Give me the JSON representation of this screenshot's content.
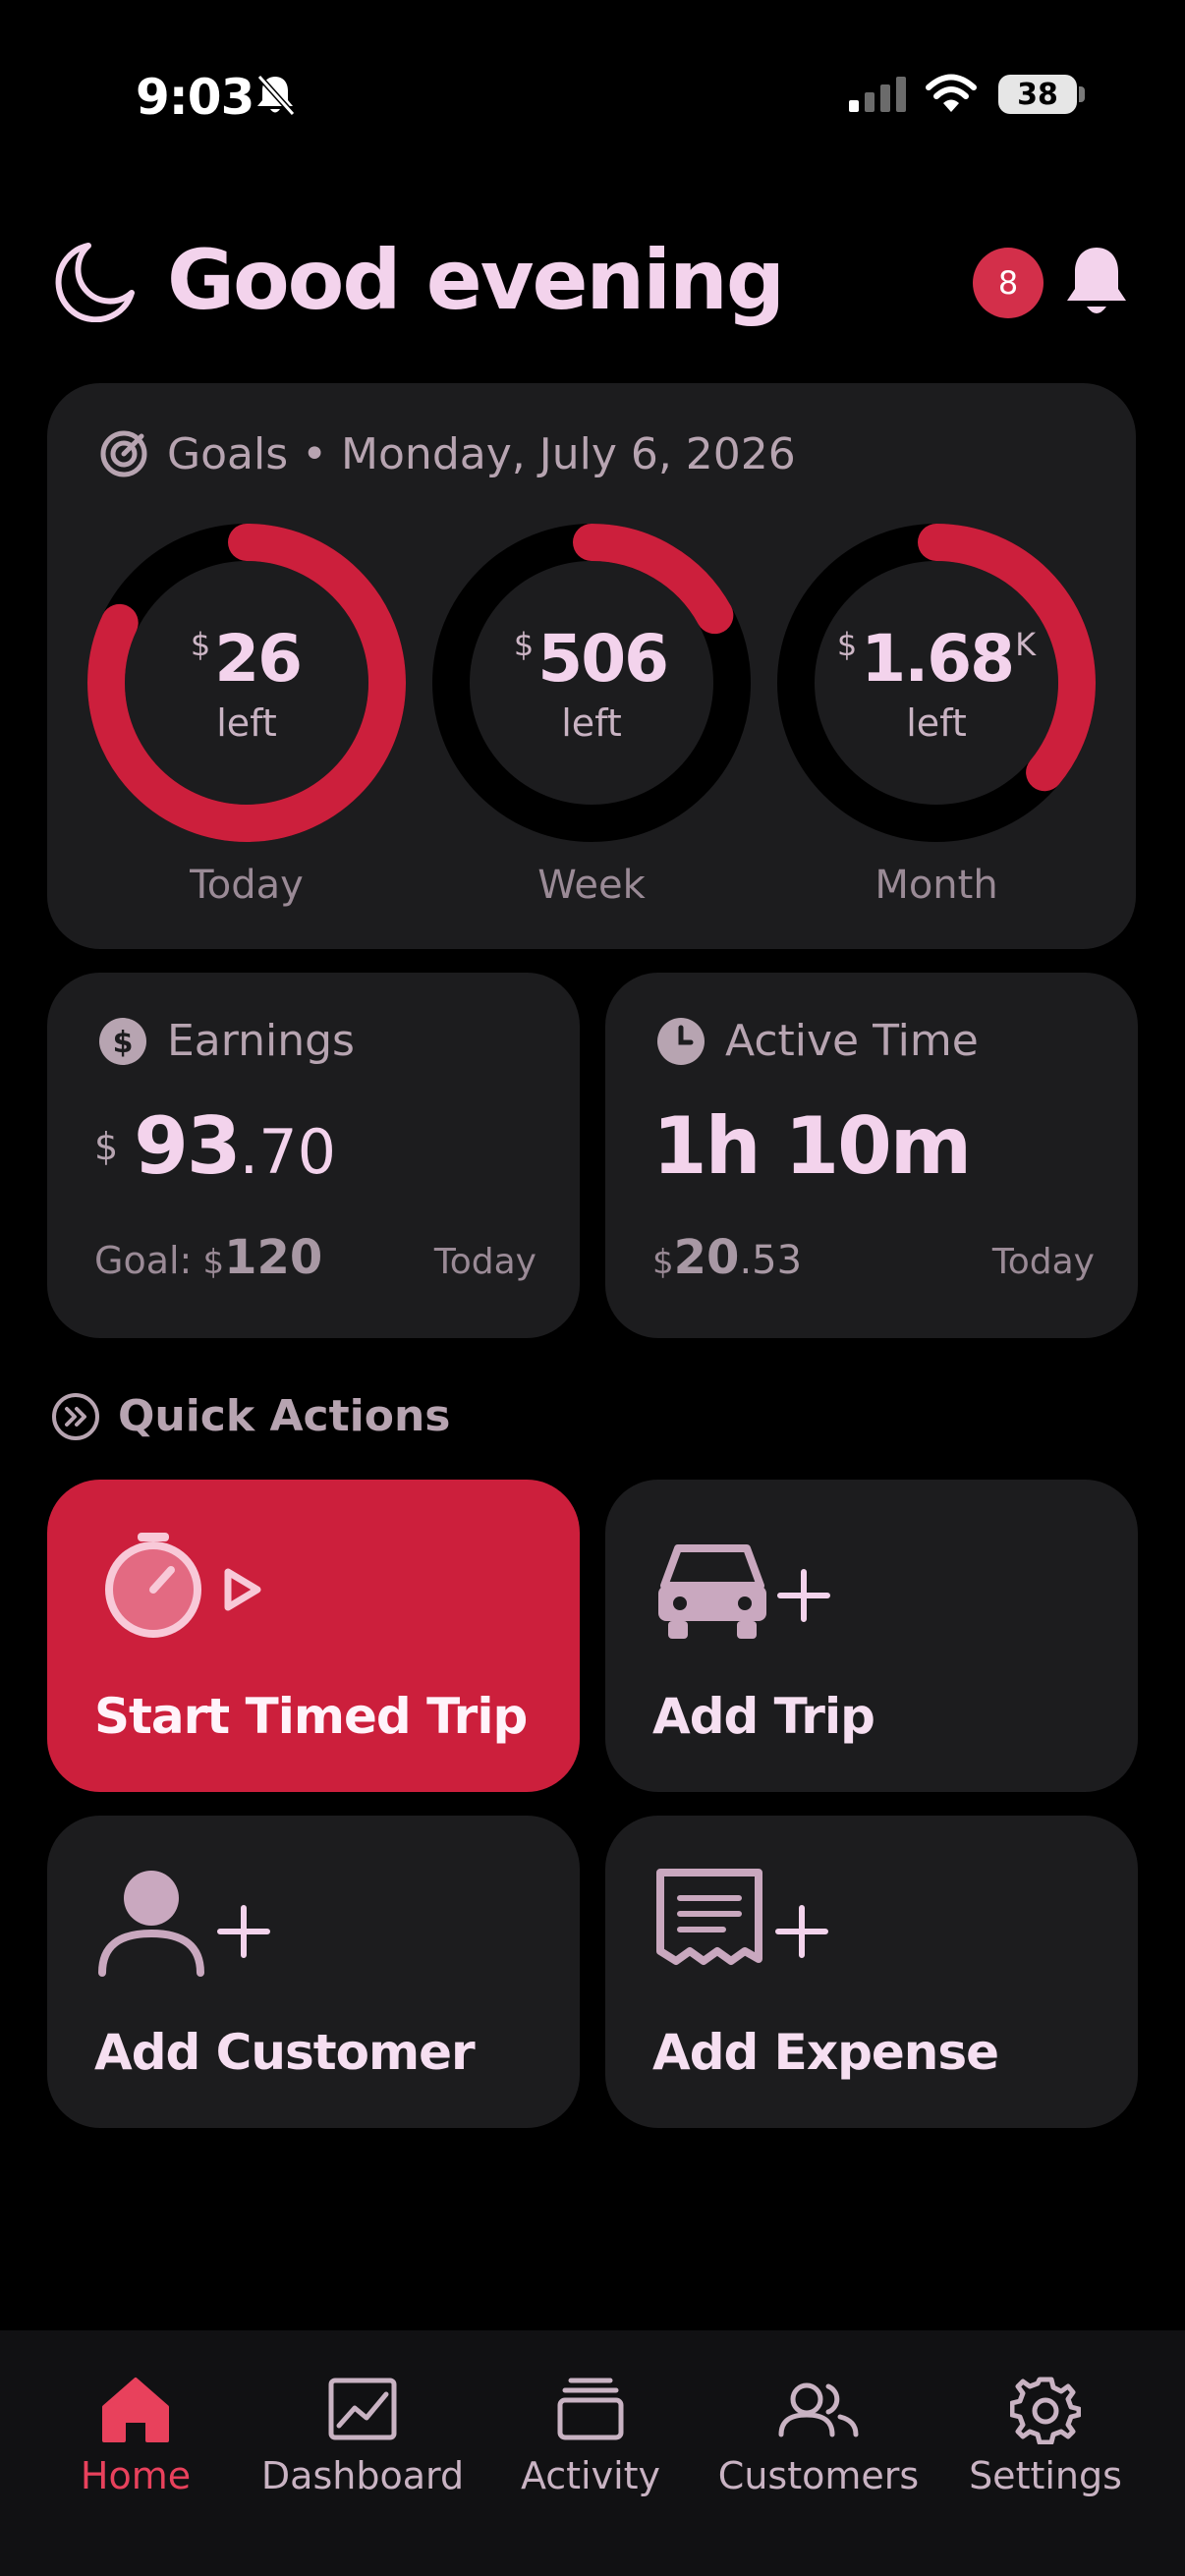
{
  "status_bar": {
    "time": "9:03",
    "battery": "38"
  },
  "header": {
    "greeting": "Good evening",
    "notification_count": "8"
  },
  "goals": {
    "title": "Goals • Monday, July 6, 2026",
    "rings": [
      {
        "label": "Today",
        "currency": "$",
        "amount": "26",
        "suffix": "",
        "sub": "left",
        "progress": 0.82
      },
      {
        "label": "Week",
        "currency": "$",
        "amount": "506",
        "suffix": "",
        "sub": "left",
        "progress": 0.17
      },
      {
        "label": "Month",
        "currency": "$",
        "amount": "1.68",
        "suffix": "K",
        "sub": "left",
        "progress": 0.36
      }
    ]
  },
  "earnings": {
    "title": "Earnings",
    "currency": "$",
    "value_int": "93",
    "value_dec": ".70",
    "goal_label": "Goal:",
    "goal_currency": "$",
    "goal_value": "120",
    "period": "Today"
  },
  "active_time": {
    "title": "Active Time",
    "value": "1h 10m",
    "rate_currency": "$",
    "rate_int": "20",
    "rate_dec": ".53",
    "period": "Today"
  },
  "quick_actions": {
    "title": "Quick Actions",
    "items": [
      {
        "label": "Start Timed Trip"
      },
      {
        "label": "Add Trip"
      },
      {
        "label": "Add Customer"
      },
      {
        "label": "Add Expense"
      }
    ]
  },
  "tabs": [
    {
      "label": "Home",
      "active": true
    },
    {
      "label": "Dashboard"
    },
    {
      "label": "Activity"
    },
    {
      "label": "Customers"
    },
    {
      "label": "Settings"
    }
  ],
  "colors": {
    "accent": "#cc1f3c",
    "text": "#f3d3ec",
    "card": "#1c1c1e",
    "muted": "#9a8a96"
  }
}
